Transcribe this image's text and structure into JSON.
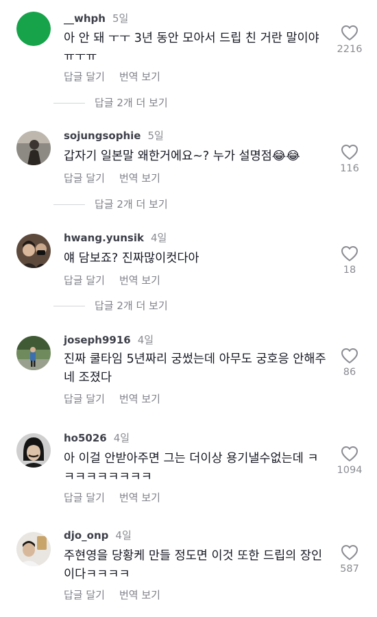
{
  "comments": [
    {
      "username": "__whph",
      "time": "5일",
      "text": "아 안 돼 ㅜㅜ 3년 동안 모아서 드립 친 거란 말이야ㅠㅜㅠ",
      "reply_label": "답글 달기",
      "translate_label": "번역 보기",
      "likes": "2216",
      "view_replies": "답글 2개 더 보기",
      "avatar": "green-circle"
    },
    {
      "username": "sojungsophie",
      "time": "5일",
      "text": "갑자기 일본말 왜한거에요~? 누가 설명점😂😂",
      "reply_label": "답글 달기",
      "translate_label": "번역 보기",
      "likes": "116",
      "view_replies": "답글 2개 더 보기",
      "avatar": "person-photo"
    },
    {
      "username": "hwang.yunsik",
      "time": "4일",
      "text": "얘 담보죠? 진짜많이컷다아",
      "reply_label": "답글 달기",
      "translate_label": "번역 보기",
      "likes": "18",
      "view_replies": "답글 2개 더 보기",
      "avatar": "person-photo"
    },
    {
      "username": "joseph9916",
      "time": "4일",
      "text": "진짜 쿨타임 5년짜리 궁썼는데 아무도 궁호응 안해주네 조졌다",
      "reply_label": "답글 달기",
      "translate_label": "번역 보기",
      "likes": "86",
      "avatar": "person-photo"
    },
    {
      "username": "ho5026",
      "time": "4일",
      "text": "아 이걸 안받아주면 그는 더이상 용기낼수없는데 ㅋㅋㅋㅋㅋㅋㅋㅋㅋ",
      "reply_label": "답글 달기",
      "translate_label": "번역 보기",
      "likes": "1094",
      "avatar": "person-photo"
    },
    {
      "username": "djo_onp",
      "time": "4일",
      "text": "주현영을 당황케 만들 정도면 이것 또한 드립의 장인이다ㅋㅋㅋㅋ",
      "reply_label": "답글 달기",
      "translate_label": "번역 보기",
      "likes": "587",
      "avatar": "person-photo"
    }
  ],
  "colors": {
    "text": "#161823",
    "secondary": "#8a8b91",
    "first_avatar": "#16a34a"
  },
  "icons": {
    "like": "heart-outline-icon"
  }
}
